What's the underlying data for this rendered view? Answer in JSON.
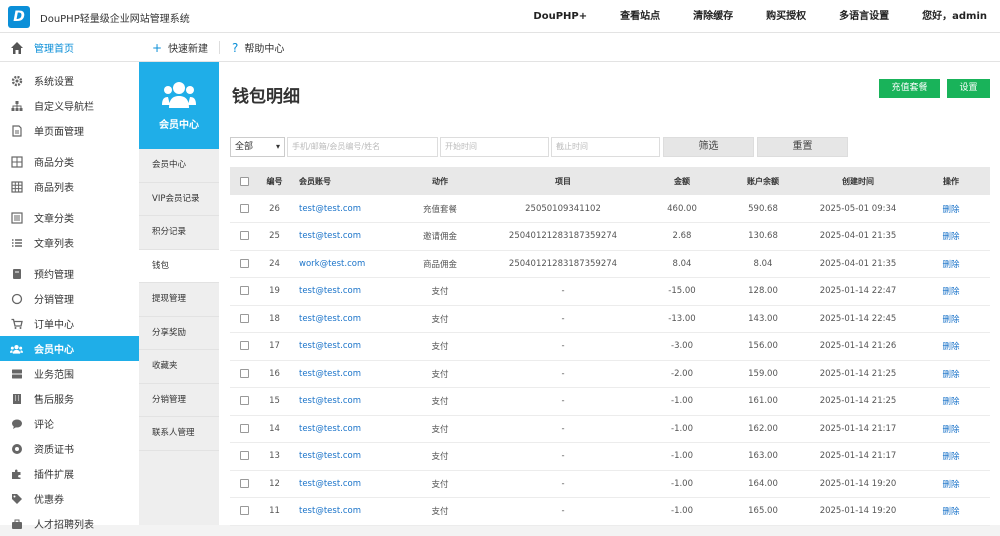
{
  "app": {
    "logo": "D",
    "title": "DouPHP轻量级企业网站管理系统"
  },
  "topnav": [
    "DouPHP+",
    "查看站点",
    "清除缓存",
    "购买授权",
    "多语言设置",
    "您好，admin"
  ],
  "quickbar": {
    "home": "管理首页",
    "new_label": "快速新建",
    "help_label": "帮助中心",
    "new_sym": "+",
    "help_sym": "?"
  },
  "sidebar": {
    "items": [
      {
        "label": "系统设置",
        "icon": "gear-icon"
      },
      {
        "label": "自定义导航栏",
        "icon": "sitemap-icon"
      },
      {
        "label": "单页面管理",
        "icon": "file-icon"
      },
      {
        "label": "商品分类",
        "icon": "grid-icon"
      },
      {
        "label": "商品列表",
        "icon": "table-icon"
      },
      {
        "label": "文章分类",
        "icon": "list-alt-icon"
      },
      {
        "label": "文章列表",
        "icon": "list-icon"
      },
      {
        "label": "预约管理",
        "icon": "book-icon"
      },
      {
        "label": "分销管理",
        "icon": "circle-icon"
      },
      {
        "label": "订单中心",
        "icon": "cart-icon"
      },
      {
        "label": "会员中心",
        "icon": "users-icon"
      },
      {
        "label": "业务范围",
        "icon": "server-icon"
      },
      {
        "label": "售后服务",
        "icon": "building-icon"
      },
      {
        "label": "评论",
        "icon": "comment-icon"
      },
      {
        "label": "资质证书",
        "icon": "certificate-icon"
      },
      {
        "label": "插件扩展",
        "icon": "puzzle-icon"
      },
      {
        "label": "优惠券",
        "icon": "tags-icon"
      },
      {
        "label": "人才招聘列表",
        "icon": "briefcase-icon"
      }
    ]
  },
  "subnav": {
    "title": "会员中心",
    "items": [
      "会员中心",
      "VIP会员记录",
      "积分记录",
      "钱包",
      "提现管理",
      "分享奖励",
      "收藏夹",
      "分销管理",
      "联系人管理"
    ]
  },
  "page": {
    "title": "钱包明细",
    "btn_recharge": "充值套餐",
    "btn_settings": "设置"
  },
  "filters": {
    "select_value": "全部",
    "keyword_placeholder": "手机/邮箱/会员编号/姓名",
    "start_placeholder": "开始时间",
    "end_placeholder": "截止时间",
    "filter_btn": "筛选",
    "reset_btn": "重置"
  },
  "table": {
    "headers": [
      "编号",
      "会员账号",
      "动作",
      "项目",
      "金额",
      "账户余额",
      "创建时间",
      "操作"
    ],
    "rows": [
      [
        "26",
        "test@test.com",
        "充值套餐",
        "25050109341102",
        "460.00",
        "590.68",
        "2025-05-01 09:34",
        "删除"
      ],
      [
        "25",
        "test@test.com",
        "邀请佣金",
        "25040121283187359274",
        "2.68",
        "130.68",
        "2025-04-01 21:35",
        "删除"
      ],
      [
        "24",
        "work@test.com",
        "商品佣金",
        "25040121283187359274",
        "8.04",
        "8.04",
        "2025-04-01 21:35",
        "删除"
      ],
      [
        "19",
        "test@test.com",
        "支付",
        "-",
        "-15.00",
        "128.00",
        "2025-01-14 22:47",
        "删除"
      ],
      [
        "18",
        "test@test.com",
        "支付",
        "-",
        "-13.00",
        "143.00",
        "2025-01-14 22:45",
        "删除"
      ],
      [
        "17",
        "test@test.com",
        "支付",
        "-",
        "-3.00",
        "156.00",
        "2025-01-14 21:26",
        "删除"
      ],
      [
        "16",
        "test@test.com",
        "支付",
        "-",
        "-2.00",
        "159.00",
        "2025-01-14 21:25",
        "删除"
      ],
      [
        "15",
        "test@test.com",
        "支付",
        "-",
        "-1.00",
        "161.00",
        "2025-01-14 21:25",
        "删除"
      ],
      [
        "14",
        "test@test.com",
        "支付",
        "-",
        "-1.00",
        "162.00",
        "2025-01-14 21:17",
        "删除"
      ],
      [
        "13",
        "test@test.com",
        "支付",
        "-",
        "-1.00",
        "163.00",
        "2025-01-14 21:17",
        "删除"
      ],
      [
        "12",
        "test@test.com",
        "支付",
        "-",
        "-1.00",
        "164.00",
        "2025-01-14 19:20",
        "删除"
      ],
      [
        "11",
        "test@test.com",
        "支付",
        "-",
        "-1.00",
        "165.00",
        "2025-01-14 19:20",
        "删除"
      ]
    ]
  },
  "colors": {
    "accent": "#1faee8",
    "green": "#19b35a",
    "link": "#1a73c9"
  }
}
